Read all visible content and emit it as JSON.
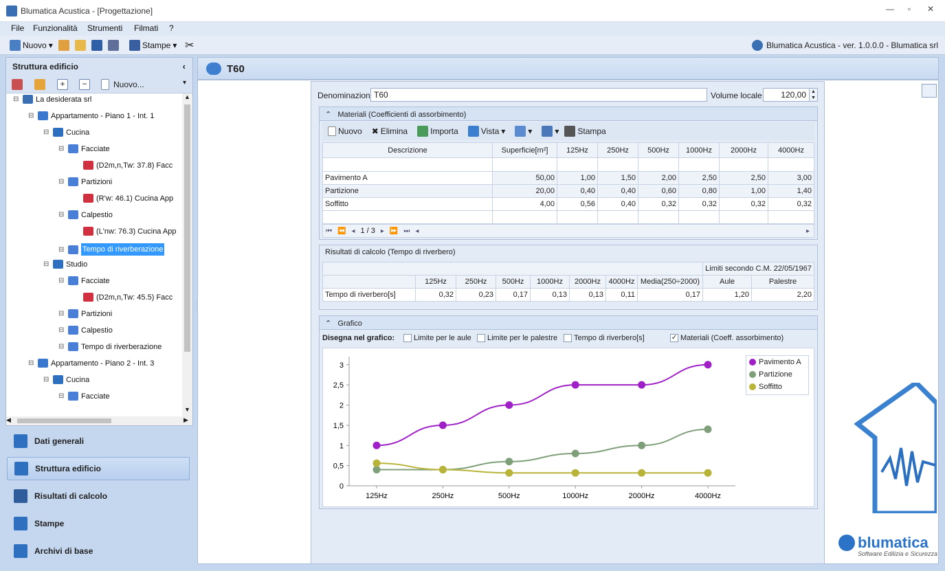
{
  "window": {
    "title": "Blumatica Acustica - [Progettazione]"
  },
  "menu": [
    "File",
    "Funzionalità",
    "Strumenti",
    "Filmati",
    "?"
  ],
  "toolbar": {
    "nuovo": "Nuovo",
    "stampe": "Stampe",
    "version": "Blumatica Acustica - ver. 1.0.0.0 - Blumatica srl"
  },
  "left": {
    "header": "Struttura edificio",
    "new_label": "Nuovo...",
    "tree": [
      {
        "label": "La desiderata srl",
        "depth": 0
      },
      {
        "label": "Appartamento - Piano 1 - Int. 1",
        "depth": 1
      },
      {
        "label": "Cucina",
        "depth": 2
      },
      {
        "label": "Facciate",
        "depth": 3
      },
      {
        "label": "(D2m,n,Tw: 37.8) Facc",
        "depth": 4
      },
      {
        "label": "Partizioni",
        "depth": 3
      },
      {
        "label": "(R'w: 46.1) Cucina App",
        "depth": 4
      },
      {
        "label": "Calpestio",
        "depth": 3
      },
      {
        "label": "(L'nw: 76.3) Cucina App",
        "depth": 4
      },
      {
        "label": "Tempo di riverberazione",
        "depth": 3,
        "selected": true
      },
      {
        "label": "Studio",
        "depth": 2
      },
      {
        "label": "Facciate",
        "depth": 3
      },
      {
        "label": "(D2m,n,Tw: 45.5) Facc",
        "depth": 4
      },
      {
        "label": "Partizioni",
        "depth": 3
      },
      {
        "label": "Calpestio",
        "depth": 3
      },
      {
        "label": "Tempo di riverberazione",
        "depth": 3
      },
      {
        "label": "Appartamento - Piano 2 - Int. 3",
        "depth": 1
      },
      {
        "label": "Cucina",
        "depth": 2
      },
      {
        "label": "Facciate",
        "depth": 3
      }
    ],
    "nav": [
      "Dati generali",
      "Struttura edificio",
      "Risultati di calcolo",
      "Stampe",
      "Archivi di base"
    ]
  },
  "page": {
    "title": "T60"
  },
  "form": {
    "denominazione_label": "Denominazione",
    "denominazione_value": "T60",
    "volume_label": "Volume locale",
    "volume_value": "120,00"
  },
  "materials": {
    "header": "Materiali (Coefficienti di assorbimento)",
    "tools": [
      "Nuovo",
      "Elimina",
      "Importa",
      "Vista",
      "Stampa"
    ],
    "columns": [
      "Descrizione",
      "Superficie[m²]",
      "125Hz",
      "250Hz",
      "500Hz",
      "1000Hz",
      "2000Hz",
      "4000Hz"
    ],
    "rows": [
      [
        "Pavimento A",
        "50,00",
        "1,00",
        "1,50",
        "2,00",
        "2,50",
        "2,50",
        "3,00"
      ],
      [
        "Partizione",
        "20,00",
        "0,40",
        "0,40",
        "0,60",
        "0,80",
        "1,00",
        "1,40"
      ],
      [
        "Soffitto",
        "4,00",
        "0,56",
        "0,40",
        "0,32",
        "0,32",
        "0,32",
        "0,32"
      ]
    ],
    "pager": "1 / 3"
  },
  "results": {
    "header": "Risultati di calcolo (Tempo di riverbero)",
    "limits_header": "Limiti secondo C.M. 22/05/1967",
    "columns": [
      "125Hz",
      "250Hz",
      "500Hz",
      "1000Hz",
      "2000Hz",
      "4000Hz",
      "Media(250÷2000)",
      "Aule",
      "Palestre"
    ],
    "row_label": "Tempo di riverbero[s]",
    "values": [
      "0,32",
      "0,23",
      "0,17",
      "0,13",
      "0,13",
      "0,11",
      "0,17",
      "1,20",
      "2,20"
    ]
  },
  "grafico": {
    "header": "Grafico",
    "draw_label": "Disegna nel grafico:",
    "options": [
      {
        "label": "Limite per le aule",
        "checked": false
      },
      {
        "label": "Limite per le palestre",
        "checked": false
      },
      {
        "label": "Tempo di riverbero[s]",
        "checked": false
      },
      {
        "label": "Materiali (Coeff. assorbimento)",
        "checked": true
      }
    ]
  },
  "chart_data": {
    "type": "line",
    "categories": [
      "125Hz",
      "250Hz",
      "500Hz",
      "1000Hz",
      "2000Hz",
      "4000Hz"
    ],
    "series": [
      {
        "name": "Pavimento A",
        "values": [
          1.0,
          1.5,
          2.0,
          2.5,
          2.5,
          3.0
        ],
        "color": "#a020c8"
      },
      {
        "name": "Partizione",
        "values": [
          0.4,
          0.4,
          0.6,
          0.8,
          1.0,
          1.4
        ],
        "color": "#7f9f7a"
      },
      {
        "name": "Soffitto",
        "values": [
          0.56,
          0.4,
          0.32,
          0.32,
          0.32,
          0.32
        ],
        "color": "#b8b43a"
      }
    ],
    "yticks": [
      "0",
      "0,5",
      "1",
      "1,5",
      "2",
      "2,5",
      "3"
    ],
    "ylim": [
      0,
      3.2
    ],
    "legend": "top-right"
  },
  "brand": {
    "name": "blumatica",
    "tagline": "Software Edilizia e Sicurezza"
  }
}
